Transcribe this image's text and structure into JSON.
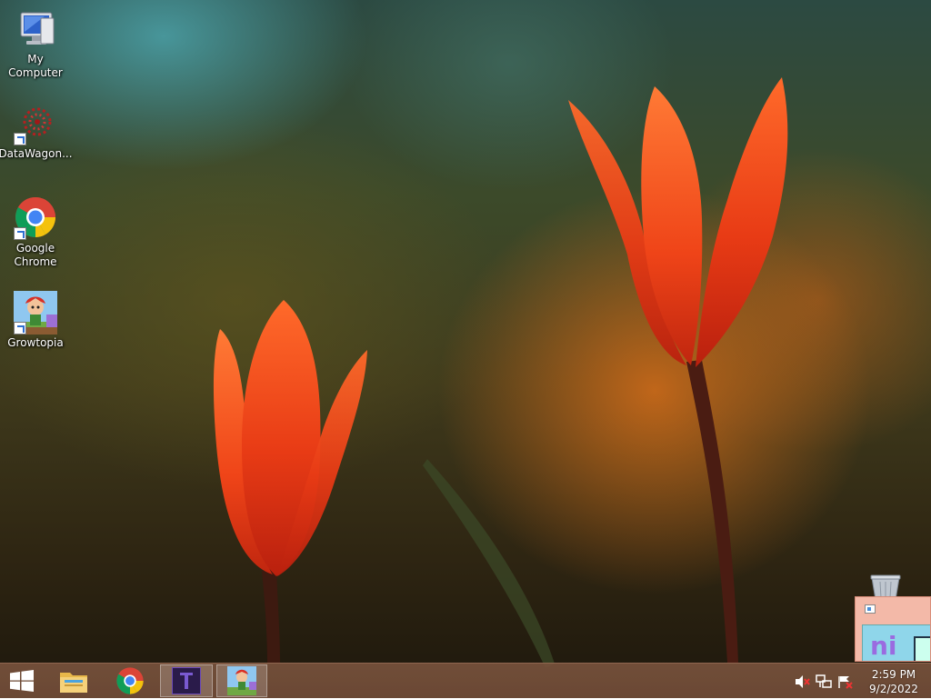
{
  "desktop": {
    "wallpaper": "red-tulips-wallpaper",
    "icons": [
      {
        "label": "My Computer",
        "icon": "computer-icon"
      },
      {
        "label": "DataWagon...",
        "icon": "datawagon-icon"
      },
      {
        "label": "Google Chrome",
        "icon": "chrome-icon"
      },
      {
        "label": "Growtopia",
        "icon": "growtopia-icon"
      }
    ],
    "recycle_bin": {
      "icon": "recycle-bin-icon"
    }
  },
  "taskbar": {
    "start": {
      "icon": "windows-start-icon"
    },
    "pinned": [
      {
        "name": "File Explorer",
        "icon": "file-explorer-icon",
        "active": false
      },
      {
        "name": "Google Chrome",
        "icon": "chrome-icon",
        "active": false
      },
      {
        "name": "App",
        "icon": "purple-app-icon",
        "active": true
      },
      {
        "name": "Growtopia",
        "icon": "growtopia-icon",
        "active": true
      }
    ],
    "tray": {
      "icons": [
        "speaker-muted-icon",
        "network-icon",
        "action-center-icon"
      ],
      "time": "2:59 PM",
      "date": "9/2/2022"
    },
    "colors": {
      "taskbar": "#7a5440",
      "accent": "#e85a2a"
    }
  },
  "thumbnail": {
    "preview_text": "ni"
  }
}
